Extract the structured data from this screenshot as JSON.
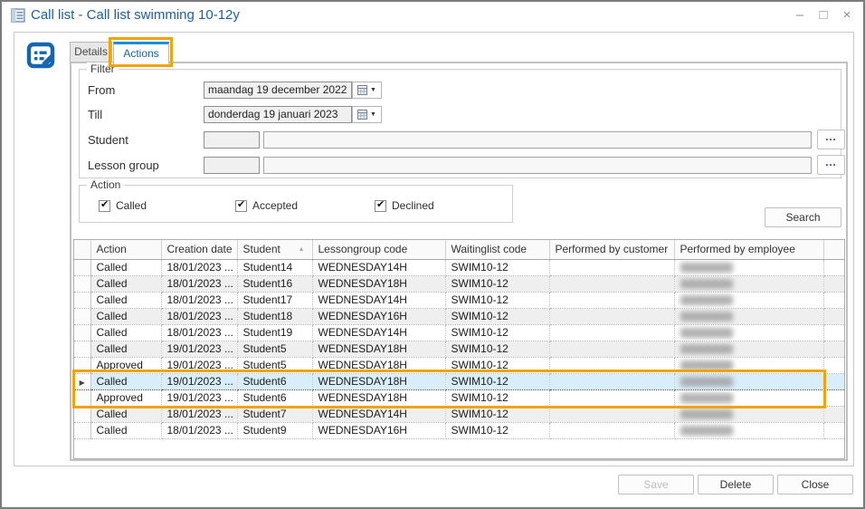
{
  "window": {
    "title": "Call list - Call list swimming 10-12y",
    "controls": {
      "minimize": "–",
      "maximize": "□",
      "close": "×"
    }
  },
  "tabs": [
    {
      "label": "Details",
      "active": false
    },
    {
      "label": "Actions",
      "active": true
    }
  ],
  "filter": {
    "legend": "Filter",
    "from": {
      "label": "From",
      "value": "maandag 19 december 2022"
    },
    "till": {
      "label": "Till",
      "value": "donderdag 19 januari 2023"
    },
    "student": {
      "label": "Student",
      "code": "",
      "name": "",
      "browse_label": "…"
    },
    "lesson_group": {
      "label": "Lesson group",
      "code": "",
      "name": "",
      "browse_label": "…"
    }
  },
  "action_filter": {
    "legend": "Action",
    "called": {
      "label": "Called",
      "checked": true
    },
    "accepted": {
      "label": "Accepted",
      "checked": true
    },
    "declined": {
      "label": "Declined",
      "checked": true
    }
  },
  "search_label": "Search",
  "grid": {
    "columns": [
      "Action",
      "Creation date",
      "Student",
      "Lessongroup code",
      "Waitinglist code",
      "Performed by customer",
      "Performed by employee"
    ],
    "sort": {
      "column": "Student",
      "direction": "ascending"
    },
    "rows": [
      {
        "action": "Called",
        "creation_date": "18/01/2023 ...",
        "student": "Student14",
        "lessongroup_code": "WEDNESDAY14H",
        "waitinglist_code": "SWIM10-12",
        "performed_by_customer": "",
        "performed_by_employee_blurred": true,
        "selected": false
      },
      {
        "action": "Called",
        "creation_date": "18/01/2023 ...",
        "student": "Student16",
        "lessongroup_code": "WEDNESDAY18H",
        "waitinglist_code": "SWIM10-12",
        "performed_by_customer": "",
        "performed_by_employee_blurred": true,
        "selected": false
      },
      {
        "action": "Called",
        "creation_date": "18/01/2023 ...",
        "student": "Student17",
        "lessongroup_code": "WEDNESDAY14H",
        "waitinglist_code": "SWIM10-12",
        "performed_by_customer": "",
        "performed_by_employee_blurred": true,
        "selected": false
      },
      {
        "action": "Called",
        "creation_date": "18/01/2023 ...",
        "student": "Student18",
        "lessongroup_code": "WEDNESDAY16H",
        "waitinglist_code": "SWIM10-12",
        "performed_by_customer": "",
        "performed_by_employee_blurred": true,
        "selected": false
      },
      {
        "action": "Called",
        "creation_date": "18/01/2023 ...",
        "student": "Student19",
        "lessongroup_code": "WEDNESDAY14H",
        "waitinglist_code": "SWIM10-12",
        "performed_by_customer": "",
        "performed_by_employee_blurred": true,
        "selected": false
      },
      {
        "action": "Called",
        "creation_date": "19/01/2023 ...",
        "student": "Student5",
        "lessongroup_code": "WEDNESDAY18H",
        "waitinglist_code": "SWIM10-12",
        "performed_by_customer": "",
        "performed_by_employee_blurred": true,
        "selected": false
      },
      {
        "action": "Approved",
        "creation_date": "19/01/2023 ...",
        "student": "Student5",
        "lessongroup_code": "WEDNESDAY18H",
        "waitinglist_code": "SWIM10-12",
        "performed_by_customer": "",
        "performed_by_employee_blurred": true,
        "selected": false
      },
      {
        "action": "Called",
        "creation_date": "19/01/2023 ...",
        "student": "Student6",
        "lessongroup_code": "WEDNESDAY18H",
        "waitinglist_code": "SWIM10-12",
        "performed_by_customer": "",
        "performed_by_employee_blurred": true,
        "selected": true
      },
      {
        "action": "Approved",
        "creation_date": "19/01/2023 ...",
        "student": "Student6",
        "lessongroup_code": "WEDNESDAY18H",
        "waitinglist_code": "SWIM10-12",
        "performed_by_customer": "",
        "performed_by_employee_blurred": true,
        "selected": false
      },
      {
        "action": "Called",
        "creation_date": "18/01/2023 ...",
        "student": "Student7",
        "lessongroup_code": "WEDNESDAY14H",
        "waitinglist_code": "SWIM10-12",
        "performed_by_customer": "",
        "performed_by_employee_blurred": true,
        "selected": false
      },
      {
        "action": "Called",
        "creation_date": "18/01/2023 ...",
        "student": "Student9",
        "lessongroup_code": "WEDNESDAY16H",
        "waitinglist_code": "SWIM10-12",
        "performed_by_customer": "",
        "performed_by_employee_blurred": true,
        "selected": false
      }
    ]
  },
  "footer": {
    "save_label": "Save",
    "save_enabled": false,
    "delete_label": "Delete",
    "close_label": "Close"
  },
  "annotations": {
    "highlight_color": "#F0A30A"
  }
}
